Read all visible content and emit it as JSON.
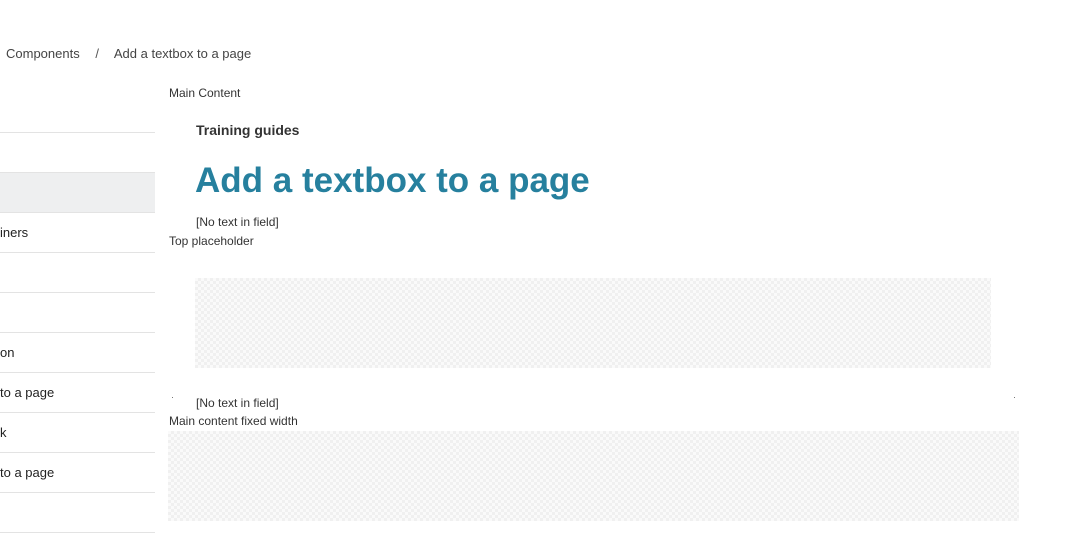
{
  "breadcrumb": {
    "items": [
      "Components",
      "Add a textbox to a page"
    ],
    "separator": "/"
  },
  "sidebar": {
    "items": [
      {
        "label": "",
        "active": false
      },
      {
        "label": "",
        "active": false
      },
      {
        "label": "",
        "active": true
      },
      {
        "label": "iners",
        "active": false
      },
      {
        "label": "",
        "active": false
      },
      {
        "label": "",
        "active": false
      },
      {
        "label": "on",
        "active": false
      },
      {
        "label": "to a page",
        "active": false
      },
      {
        "label": "k",
        "active": false
      },
      {
        "label": "to a page",
        "active": false
      },
      {
        "label": "",
        "active": false
      }
    ]
  },
  "main": {
    "region_label": "Main Content",
    "section_label": "Training guides",
    "title": "Add a textbox to a page",
    "empty_field_text_1": "[No text in field]",
    "top_placeholder_label": "Top placeholder",
    "empty_field_text_2": "[No text in field]",
    "fixed_width_label": "Main content fixed width"
  },
  "colors": {
    "title": "#26809e",
    "active_item_bg": "#eeeff0"
  }
}
